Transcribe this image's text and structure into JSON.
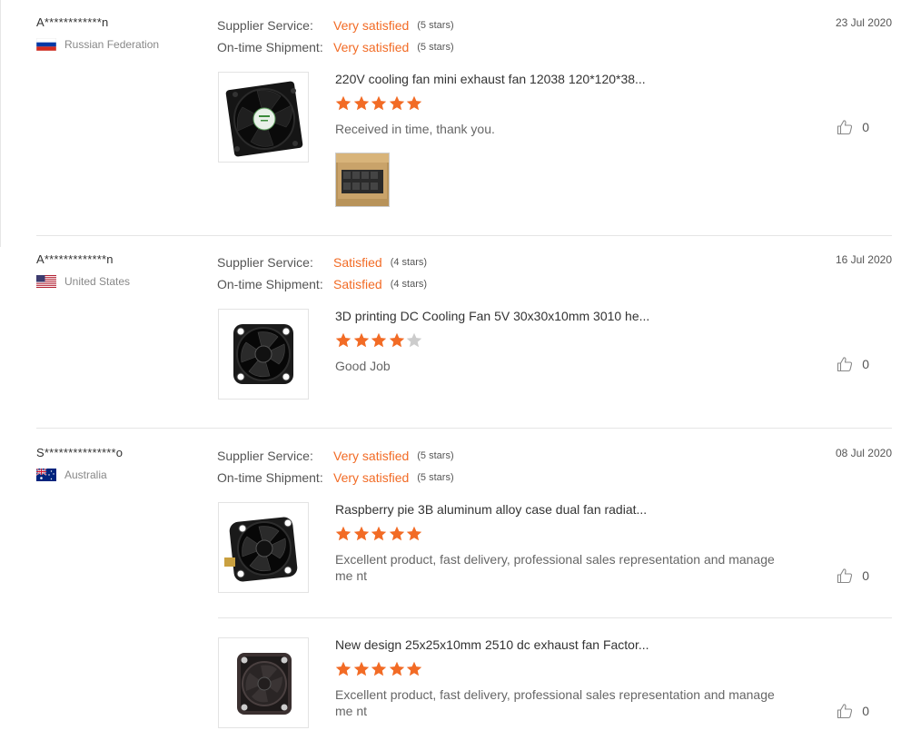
{
  "reviews": [
    {
      "user": "A************n",
      "country": "Russian Federation",
      "flag": "ru",
      "supplier_label": "Supplier Service:",
      "supplier_value": "Very satisfied",
      "supplier_stars": "(5 stars)",
      "shipment_label": "On-time Shipment:",
      "shipment_value": "Very satisfied",
      "shipment_stars": "(5 stars)",
      "date": "23 Jul 2020",
      "products": [
        {
          "title": "220V cooling fan mini exhaust fan 12038 120*120*38...",
          "rating": 5,
          "comment": "Received in time, thank you.",
          "likes": "0",
          "image_icon": "cooling-fan-120mm-icon",
          "has_photo": true
        }
      ]
    },
    {
      "user": "A*************n",
      "country": "United States",
      "flag": "us",
      "supplier_label": "Supplier Service:",
      "supplier_value": "Satisfied",
      "supplier_stars": "(4 stars)",
      "shipment_label": "On-time Shipment:",
      "shipment_value": "Satisfied",
      "shipment_stars": "(4 stars)",
      "date": "16 Jul 2020",
      "products": [
        {
          "title": "3D printing DC Cooling Fan 5V 30x30x10mm 3010 he...",
          "rating": 4,
          "comment": "Good Job",
          "likes": "0",
          "image_icon": "cooling-fan-30mm-icon"
        }
      ]
    },
    {
      "user": "S***************o",
      "country": "Australia",
      "flag": "au",
      "supplier_label": "Supplier Service:",
      "supplier_value": "Very satisfied",
      "supplier_stars": "(5 stars)",
      "shipment_label": "On-time Shipment:",
      "shipment_value": "Very satisfied",
      "shipment_stars": "(5 stars)",
      "date": "08 Jul 2020",
      "products": [
        {
          "title": "Raspberry pie 3B aluminum alloy case dual fan radiat...",
          "rating": 5,
          "comment": "Excellent product, fast delivery, professional sales representation and manageme nt",
          "likes": "0",
          "image_icon": "cooling-fan-30mm-icon"
        },
        {
          "title": "New design 25x25x10mm 2510 dc exhaust fan Factor...",
          "rating": 5,
          "comment": "Excellent product, fast delivery, professional sales representation and manageme nt",
          "likes": "0",
          "image_icon": "cooling-fan-25mm-icon"
        }
      ]
    }
  ],
  "colors": {
    "accent": "#f26b25",
    "star_on": "#f26b25",
    "star_off": "#cccccc"
  }
}
